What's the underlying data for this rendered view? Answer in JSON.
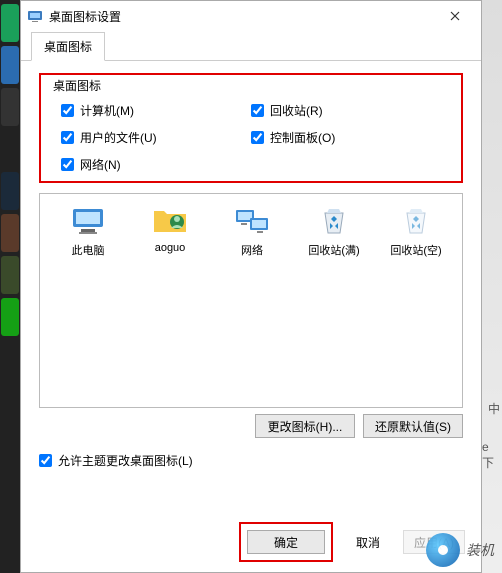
{
  "titlebar": {
    "title": "桌面图标设置"
  },
  "tabs": {
    "active": "桌面图标"
  },
  "group": {
    "label": "桌面图标",
    "items": [
      {
        "label": "计算机(M)",
        "checked": true
      },
      {
        "label": "回收站(R)",
        "checked": true
      },
      {
        "label": "用户的文件(U)",
        "checked": true
      },
      {
        "label": "控制面板(O)",
        "checked": true
      },
      {
        "label": "网络(N)",
        "checked": true
      }
    ]
  },
  "icons": [
    {
      "label": "此电脑",
      "name": "this-pc-icon"
    },
    {
      "label": "aoguo",
      "name": "user-folder-icon"
    },
    {
      "label": "网络",
      "name": "network-icon"
    },
    {
      "label": "回收站(满)",
      "name": "recycle-full-icon"
    },
    {
      "label": "回收站(空)",
      "name": "recycle-empty-icon"
    }
  ],
  "buttons": {
    "change_icon": "更改图标(H)...",
    "restore_default": "还原默认值(S)",
    "ok": "确定",
    "cancel": "取消",
    "apply": "应用(A)"
  },
  "theme_check": {
    "label": "允许主题更改桌面图标(L)",
    "checked": true
  },
  "watermark": {
    "text": "装机"
  },
  "bg": {
    "text1": "中",
    "text2": "e 下"
  }
}
